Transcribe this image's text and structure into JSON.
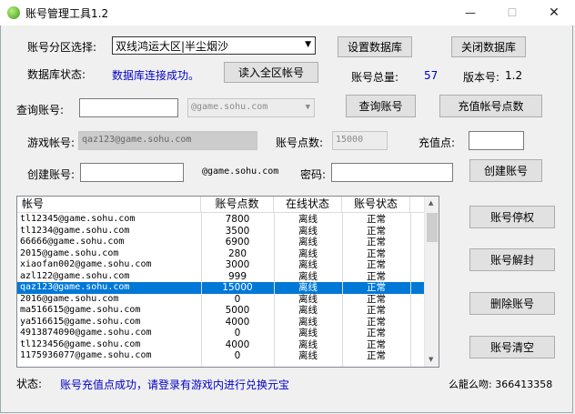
{
  "window": {
    "title": "账号管理工具1.2",
    "minimize": "—",
    "maximize": "☐",
    "close": "✕"
  },
  "server": {
    "label": "账号分区选择:",
    "selected": "双线鸿运大区|半尘烟沙"
  },
  "db": {
    "status_label": "数据库状态:",
    "status_value": "数据库连接成功。",
    "load_all": "读入全区帐号",
    "set_db": "设置数据库",
    "close_db": "关闭数据库"
  },
  "totals": {
    "count_label": "账号总量:",
    "count_value": "57",
    "version_label": "版本号:",
    "version_value": "1.2"
  },
  "query": {
    "label": "查询账号:",
    "domain": "@game.sohu.com",
    "query_button": "查询账号",
    "recharge_button": "充值帐号点数"
  },
  "game": {
    "label": "游戏帐号:",
    "value": "qaz123@game.sohu.com",
    "points_label": "账号点数:",
    "points_value": "15000",
    "recharge_label": "充值点:",
    "recharge_value": ""
  },
  "create": {
    "label": "创建账号:",
    "domain": "@game.sohu.com",
    "password_label": "密码:",
    "button": "创建账号"
  },
  "table": {
    "columns": [
      "帐号",
      "账号点数",
      "在线状态",
      "账号状态"
    ],
    "rows": [
      [
        "tl12345@game.sohu.com",
        "7800",
        "离线",
        "正常"
      ],
      [
        "tl1234@game.sohu.com",
        "3500",
        "离线",
        "正常"
      ],
      [
        "66666@game.sohu.com",
        "6900",
        "离线",
        "正常"
      ],
      [
        "2015@game.sohu.com",
        "280",
        "离线",
        "正常"
      ],
      [
        "xiaofan002@game.sohu.com",
        "3000",
        "离线",
        "正常"
      ],
      [
        "azl122@game.sohu.com",
        "999",
        "离线",
        "正常"
      ],
      [
        "qaz123@game.sohu.com",
        "15000",
        "离线",
        "正常"
      ],
      [
        "2016@game.sohu.com",
        "0",
        "离线",
        "正常"
      ],
      [
        "ma516615@game.sohu.com",
        "5000",
        "离线",
        "正常"
      ],
      [
        "ya516615@game.sohu.com",
        "4000",
        "离线",
        "正常"
      ],
      [
        "4913874090@game.sohu.com",
        "0",
        "离线",
        "正常"
      ],
      [
        "tl123456@game.sohu.com",
        "4000",
        "离线",
        "正常"
      ],
      [
        "1175936077@game.sohu.com",
        "0",
        "离线",
        "正常"
      ]
    ],
    "selected_index": 6
  },
  "side": {
    "stop": "账号停权",
    "unlock": "账号解封",
    "delete": "删除账号",
    "clear": "账号清空"
  },
  "status": {
    "label": "状态:",
    "message": "账号充值点成功，请登录有游戏内进行兑换元宝",
    "qq": "么龍么吻: 366413358"
  },
  "colors": {
    "accent": "#0078d7",
    "status_blue": "#0000c8"
  }
}
